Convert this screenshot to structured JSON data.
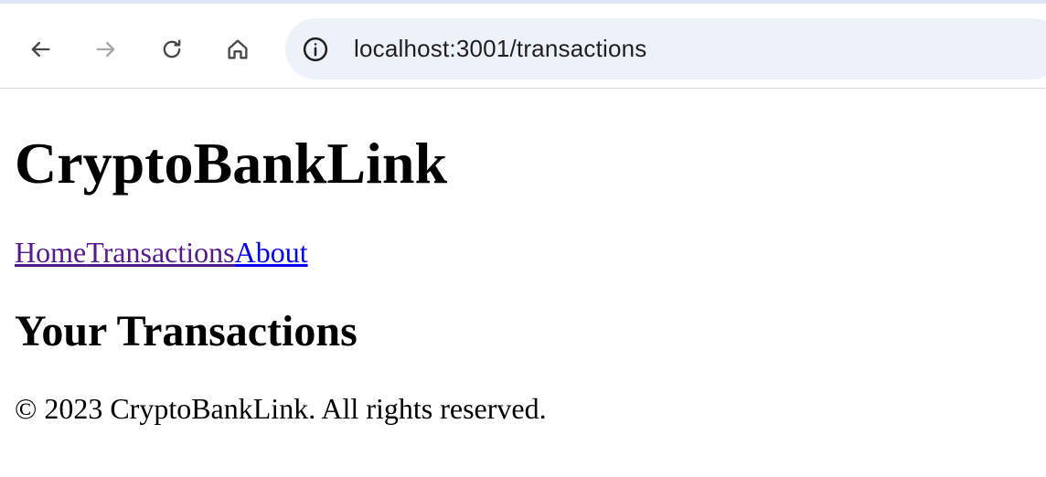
{
  "browser": {
    "url": "localhost:3001/transactions"
  },
  "site": {
    "title": "CryptoBankLink"
  },
  "nav": {
    "items": [
      {
        "label": "Home"
      },
      {
        "label": "Transactions"
      },
      {
        "label": "About"
      }
    ]
  },
  "main": {
    "heading": "Your Transactions"
  },
  "footer": {
    "text": "© 2023 CryptoBankLink. All rights reserved."
  },
  "colors": {
    "visited_link": "#551a8b",
    "link": "#0000ee",
    "omnibox_bg": "#edf2fa"
  }
}
